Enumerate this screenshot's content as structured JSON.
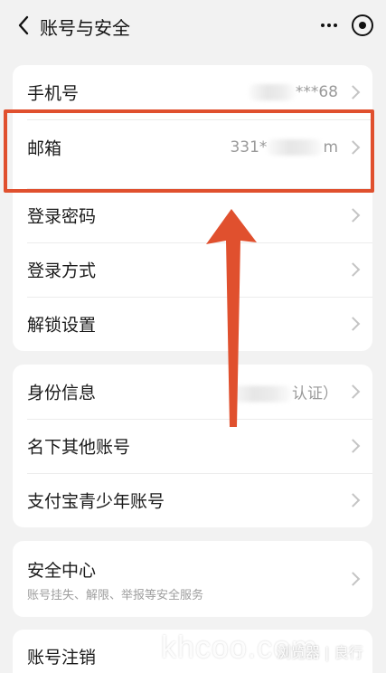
{
  "header": {
    "title": "账号与安全",
    "back_icon": "chevron-left-icon",
    "more_icon": "more-dots-icon",
    "target_icon": "record-target-icon"
  },
  "group1": {
    "items": [
      {
        "label": "手机号",
        "value": "***68"
      },
      {
        "label": "邮箱",
        "value_prefix": "331*",
        "value_suffix": "m"
      },
      {
        "label": "登录密码"
      },
      {
        "label": "登录方式"
      },
      {
        "label": "解锁设置"
      }
    ]
  },
  "group2": {
    "items": [
      {
        "label": "身份信息",
        "value": "认证）"
      },
      {
        "label": "名下其他账号"
      },
      {
        "label": "支付宝青少年账号"
      }
    ]
  },
  "group3": {
    "title": "安全中心",
    "subtitle": "账号挂失、解限、举报等安全服务"
  },
  "group4": {
    "title": "账号注销"
  },
  "watermark": {
    "main": "khcoo.com",
    "secondary": "浏览器 | 良行"
  },
  "colors": {
    "annotation": "#e0502e"
  }
}
